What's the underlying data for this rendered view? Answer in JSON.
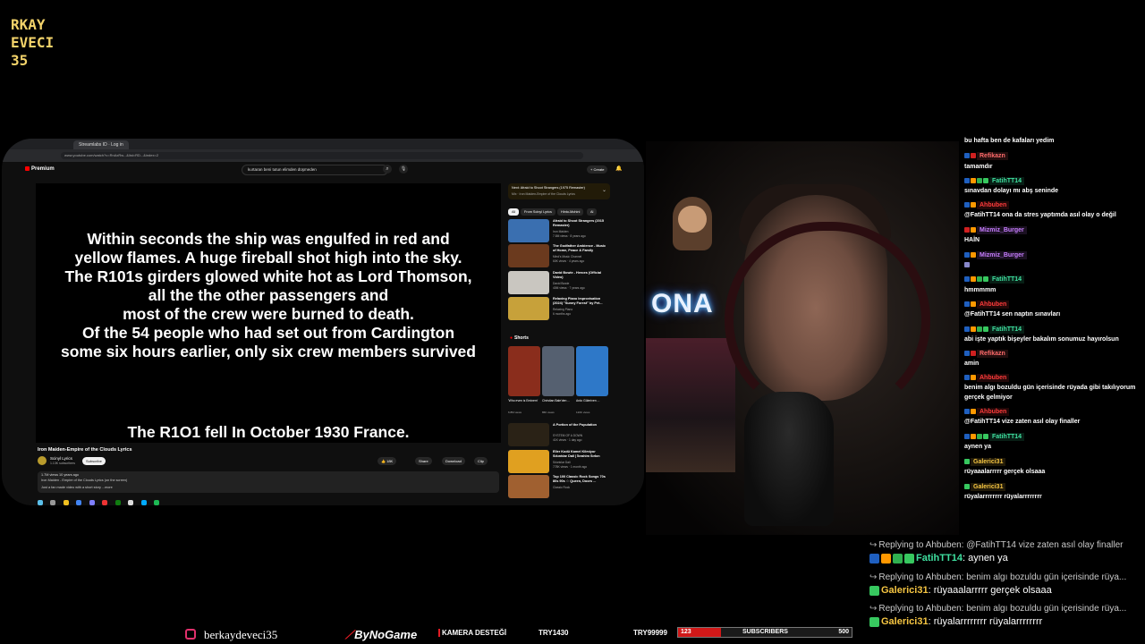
{
  "logo": {
    "lines": [
      "RKAY",
      "EVECI",
      "35"
    ]
  },
  "browser": {
    "tabs": [
      "Streamlabs ID · Log in"
    ],
    "url": "www.youtube.com/watch?v=RnAxRw...&list=RD...&index=2",
    "yt_logo": "Premium",
    "search_value": "kurtaran beni tutun elimden düşmeden",
    "create_label": "+ Create",
    "lyrics": [
      "Within seconds the ship was engulfed in red and",
      "yellow flames. A huge fireball shot high into the sky.",
      "The R101s girders glowed white hot as Lord Thomson,",
      "all the the other passengers and",
      "most of the crew were burned to death.",
      "Of the 54 people who had set out from Cardington",
      "some six hours earlier, only six crew members survived"
    ],
    "lyric_final": "The R1O1 fell In October 1930 France.",
    "video_title": "Iron Maiden-Empire of the Clouds Lyrics",
    "channel_name": "Scinyl Lyrics",
    "channel_subs": "1.13K subscribers",
    "subscribe_label": "Subscribe",
    "actions": [
      "18K",
      "Share",
      "Download",
      "Clip"
    ],
    "desc_views": "1.7M views  10 years ago",
    "desc_text": "Iron Maiden - Empire of the Clouds Lyrics (on the screen)",
    "desc_more": "Just a fan made video with a short story ...more",
    "next": {
      "label": "Next: Afraid to Shoot Strangers (1975 Remaster)",
      "sub": "Mix · Iron Maiden-Empire of the Clouds Lyrics"
    },
    "chips": [
      "All",
      "From Scinyl Lyrics",
      "Hinto-Mohini",
      "Al"
    ],
    "recs": [
      {
        "title": "Afraid to Shoot Strangers (2015 Remaster)",
        "channel": "Iron Maiden",
        "views": "7.8M views · 8 years ago",
        "color": "#3a6fb0"
      },
      {
        "title": "The Godfather Ambience - Music of Home, Peace & Family",
        "channel": "Mind's Music Channel",
        "views": "60K views · 4 years ago",
        "color": "#6b3a1e"
      },
      {
        "title": "David Bowie - Heroes (Official Video)",
        "channel": "David Bowie",
        "views": "40M views · 7 years ago",
        "color": "#c9c6c0"
      },
      {
        "title": "Relaxing Piano Improvisation (2024) \"Sunny Forest\" by Pet...",
        "channel": "Relaxing Piano",
        "views": "6 months ago",
        "color": "#c7a13a"
      }
    ],
    "shorts_label": "Shorts",
    "shorts": [
      {
        "title": "'Who even is Eminem'",
        "views": "6.8M views",
        "color": "#8a2d1c"
      },
      {
        "title": "Christian Bale'den ...",
        "views": "86K views",
        "color": "#556070"
      },
      {
        "title": "Ardo Güleriven ...",
        "views": "120K views",
        "color": "#2e78c8"
      }
    ],
    "recs2": [
      {
        "title": "A Portion of the Population",
        "channel": "SYSTEM OF A DOWN",
        "views": "41K views · 1 day ago",
        "color": "#2a2216"
      },
      {
        "title": "Eller Kodü Kamel Kilmiyor Sıkıntılar Dali | İbrahim Sırkın",
        "channel": "Sıkıntılar Dali",
        "views": "778K views · 1 month ago",
        "color": "#e0a020"
      },
      {
        "title": "Top 100 Classic Rock Songs 70s 80s 90s ☆ Queen, Doors ...",
        "channel": "Classic Rock",
        "views": "",
        "color": "#a06030"
      }
    ]
  },
  "chat": {
    "messages": [
      {
        "user": "",
        "text": "bu hafta ben de kafaları yedim",
        "color": "#ffffff",
        "badges": []
      },
      {
        "user": "Refikazn",
        "text": "",
        "color": "#ff6b6b",
        "badges": [
          "#1f5fbf",
          "#d02020"
        ]
      },
      {
        "user": "",
        "text": "tamamdır",
        "color": "#ffffff",
        "badges": []
      },
      {
        "user": "FatihTT14",
        "text": "",
        "color": "#3fe0a0",
        "badges": [
          "#1f5fbf",
          "#ff9800",
          "#30b050",
          "#37c85f"
        ]
      },
      {
        "user": "",
        "text": "sınavdan dolayı mı abş seninde",
        "color": "#ffffff",
        "badges": []
      },
      {
        "user": "Ahbuben",
        "text": "",
        "color": "#ff3b3b",
        "badges": [
          "#1f5fbf",
          "#ff9800"
        ]
      },
      {
        "user": "",
        "text": "@FatihTT14 ona da stres yaptımda asıl olay o değil",
        "color": "#ffffff",
        "badges": []
      },
      {
        "user": "Mizmiz_Burger",
        "text": "",
        "color": "#c77dff",
        "badges": [
          "#d02020",
          "#ff9800"
        ]
      },
      {
        "user": "",
        "text": "HAİN",
        "color": "#ffffff",
        "badges": []
      },
      {
        "user": "Mizmiz_Burger",
        "text": "",
        "color": "#c77dff",
        "badges": [
          "#1f5fbf",
          "#ff9800"
        ]
      },
      {
        "user": "",
        "text": "",
        "color": "#ffffff",
        "badges": [
          "#8888cc"
        ]
      },
      {
        "user": "FatihTT14",
        "text": "",
        "color": "#3fe0a0",
        "badges": [
          "#1f5fbf",
          "#ff9800",
          "#30b050",
          "#37c85f"
        ]
      },
      {
        "user": "",
        "text": "hmmmmm",
        "color": "#ffffff",
        "badges": []
      },
      {
        "user": "Ahbuben",
        "text": "",
        "color": "#ff3b3b",
        "badges": [
          "#1f5fbf",
          "#ff9800"
        ]
      },
      {
        "user": "",
        "text": "@FatihTT14 sen naptın sınavları",
        "color": "#ffffff",
        "badges": []
      },
      {
        "user": "FatihTT14",
        "text": "",
        "color": "#3fe0a0",
        "badges": [
          "#1f5fbf",
          "#ff9800",
          "#30b050",
          "#37c85f"
        ]
      },
      {
        "user": "",
        "text": "abi işte yaptık bişeyler bakalım sonumuz hayırolsun",
        "color": "#ffffff",
        "badges": []
      },
      {
        "user": "Refikazn",
        "text": "",
        "color": "#ff6b6b",
        "badges": [
          "#1f5fbf",
          "#d02020"
        ]
      },
      {
        "user": "",
        "text": "amin",
        "color": "#ffffff",
        "badges": []
      },
      {
        "user": "Ahbuben",
        "text": "",
        "color": "#ff3b3b",
        "badges": [
          "#1f5fbf",
          "#ff9800"
        ]
      },
      {
        "user": "",
        "text": "benim algı bozuldu gün içerisinde rüyada gibi takılıyorum",
        "color": "#ffffff",
        "badges": []
      },
      {
        "user": "",
        "text": "gerçek gelmiyor",
        "color": "#ffffff",
        "badges": []
      },
      {
        "user": "Ahbuben",
        "text": "",
        "color": "#ff3b3b",
        "badges": [
          "#1f5fbf",
          "#ff9800"
        ]
      },
      {
        "user": "",
        "text": "@FatihTT14 vize zaten asıl olay finaller",
        "color": "#ffffff",
        "badges": []
      },
      {
        "user": "FatihTT14",
        "text": "",
        "color": "#3fe0a0",
        "badges": [
          "#1f5fbf",
          "#ff9800",
          "#30b050",
          "#37c85f"
        ]
      },
      {
        "user": "",
        "text": "aynen ya",
        "color": "#ffffff",
        "badges": []
      },
      {
        "user": "Galerici31",
        "text": "",
        "color": "#f5c542",
        "badges": [
          "#37c85f"
        ]
      },
      {
        "user": "",
        "text": "rüyaaalarrrrr gerçek olsaaa",
        "color": "#ffffff",
        "badges": []
      },
      {
        "user": "Galerici31",
        "text": "",
        "color": "#f5c542",
        "badges": [
          "#37c85f"
        ]
      },
      {
        "user": "",
        "text": "rüyalarrrrrrrr rüyalarrrrrrrr",
        "color": "#ffffff",
        "badges": []
      }
    ]
  },
  "replies": [
    {
      "reply_to": "Replying to Ahbuben: @FatihTT14 vize zaten asıl olay finaller",
      "user": "FatihTT14",
      "text": "aynen ya",
      "color": "#3fe0a0",
      "badges": [
        "#1f5fbf",
        "#ff9800",
        "#30b050",
        "#37c85f"
      ]
    },
    {
      "reply_to": "Replying to Ahbuben: benim algı bozuldu gün içerisinde rüya...",
      "user": "Galerici31",
      "text": "rüyaaalarrrrr gerçek olsaaa",
      "color": "#f5c542",
      "badges": [
        "#37c85f"
      ]
    },
    {
      "reply_to": "Replying to Ahbuben: benim algı bozuldu gün içerisinde rüya...",
      "user": "Galerici31",
      "text": "rüyalarrrrrrrr rüyalarrrrrrrr",
      "color": "#f5c542",
      "badges": [
        "#37c85f"
      ]
    }
  ],
  "bottom": {
    "instagram": "berkaydeveci35",
    "bynogame": "ByNoGame",
    "kamera": "KAMERA DESTEĞİ",
    "try1": "TRY1430",
    "try2": "TRY99999",
    "subs_current": "123",
    "subs_label": "SUBSCRIBERS",
    "subs_goal": "500",
    "subs_progress": 0.246
  },
  "colors": {
    "accent": "#e31b23",
    "youtube_red": "#ff0000"
  }
}
